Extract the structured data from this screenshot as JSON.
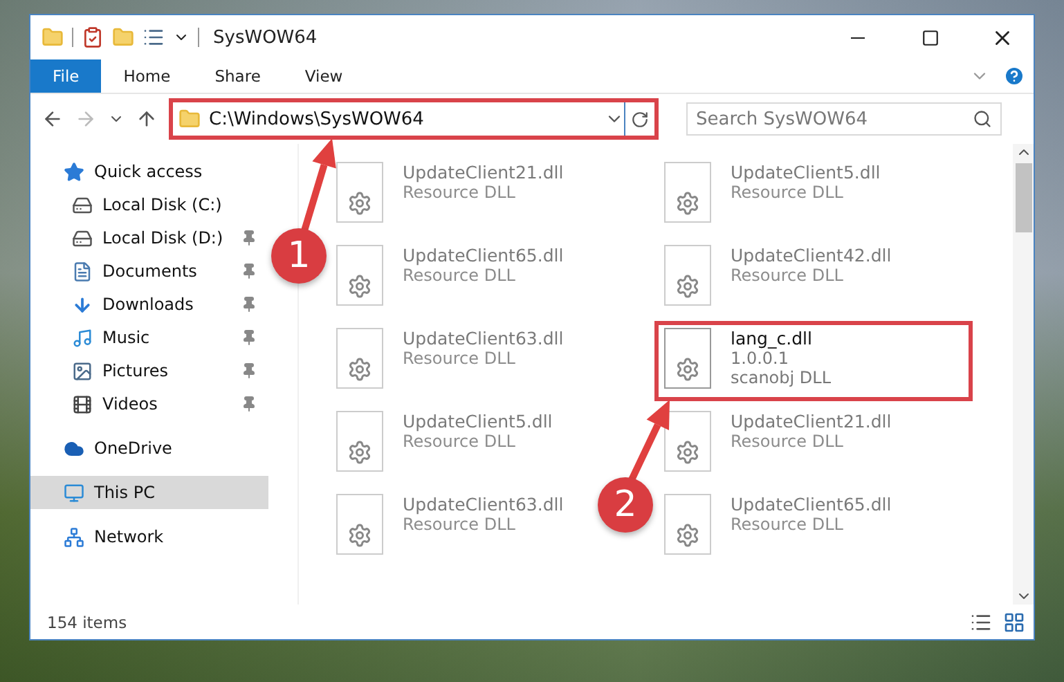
{
  "window": {
    "title": "SysWOW64"
  },
  "ribbon": {
    "tabs": [
      {
        "label": "File",
        "selected": true
      },
      {
        "label": "Home",
        "selected": false
      },
      {
        "label": "Share",
        "selected": false
      },
      {
        "label": "View",
        "selected": false
      }
    ]
  },
  "address": {
    "path": "C:\\Windows\\SysWOW64",
    "highlighted": true
  },
  "search": {
    "placeholder": "Search SysWOW64"
  },
  "sidebar": {
    "items": [
      {
        "label": "Quick access",
        "kind": "star",
        "selected": false,
        "children": [
          {
            "label": "Local Disk (C:)",
            "kind": "drive-c",
            "pinned": false,
            "selected": false
          },
          {
            "label": "Local Disk (D:)",
            "kind": "drive",
            "pinned": true,
            "selected": false
          },
          {
            "label": "Documents",
            "kind": "documents",
            "pinned": true,
            "selected": false
          },
          {
            "label": "Downloads",
            "kind": "downloads",
            "pinned": true,
            "selected": false
          },
          {
            "label": "Music",
            "kind": "music",
            "pinned": true,
            "selected": false
          },
          {
            "label": "Pictures",
            "kind": "pictures",
            "pinned": true,
            "selected": false
          },
          {
            "label": "Videos",
            "kind": "videos",
            "pinned": true,
            "selected": false
          }
        ]
      },
      {
        "label": "OneDrive",
        "kind": "cloud",
        "selected": false
      },
      {
        "label": "This PC",
        "kind": "pc",
        "selected": true
      },
      {
        "label": "Network",
        "kind": "network",
        "selected": false
      }
    ]
  },
  "files": [
    {
      "name": "UpdateClient21.dll",
      "lines": [
        "Resource DLL"
      ],
      "faded": true,
      "highlighted": false
    },
    {
      "name": "UpdateClient5.dll",
      "lines": [
        "Resource DLL"
      ],
      "faded": true,
      "highlighted": false
    },
    {
      "name": "UpdateClient65.dll",
      "lines": [
        "Resource DLL"
      ],
      "faded": true,
      "highlighted": false
    },
    {
      "name": "UpdateClient42.dll",
      "lines": [
        "Resource DLL"
      ],
      "faded": true,
      "highlighted": false
    },
    {
      "name": "UpdateClient63.dll",
      "lines": [
        "Resource DLL"
      ],
      "faded": true,
      "highlighted": false
    },
    {
      "name": "lang_c.dll",
      "lines": [
        "1.0.0.1",
        "scanobj DLL"
      ],
      "faded": false,
      "highlighted": true
    },
    {
      "name": "UpdateClient5.dll",
      "lines": [
        "Resource DLL"
      ],
      "faded": true,
      "highlighted": false
    },
    {
      "name": "UpdateClient21.dll",
      "lines": [
        "Resource DLL"
      ],
      "faded": true,
      "highlighted": false
    },
    {
      "name": "UpdateClient63.dll",
      "lines": [
        "Resource DLL"
      ],
      "faded": true,
      "highlighted": false
    },
    {
      "name": "UpdateClient65.dll",
      "lines": [
        "Resource DLL"
      ],
      "faded": true,
      "highlighted": false
    }
  ],
  "status_bar": {
    "count": "154 items"
  },
  "annotations": [
    {
      "number": "1"
    },
    {
      "number": "2"
    }
  ]
}
